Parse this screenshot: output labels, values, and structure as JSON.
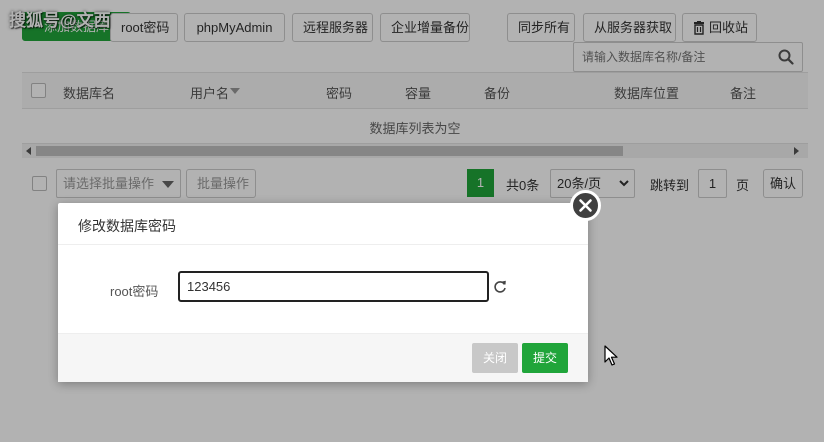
{
  "watermark": "搜狐号@文西",
  "toolbar": {
    "add_db": "添加数据库",
    "root_pw": "root密码",
    "phpmyadmin": "phpMyAdmin",
    "remote_server": "远程服务器",
    "enterprise_backup": "企业增量备份",
    "sync_all": "同步所有",
    "fetch_from_server": "从服务器获取",
    "recycle_bin": "回收站"
  },
  "search": {
    "placeholder": "请输入数据库名称/备注"
  },
  "table": {
    "columns": [
      "数据库名",
      "用户名",
      "密码",
      "容量",
      "备份",
      "数据库位置",
      "备注"
    ],
    "empty_text": "数据库列表为空"
  },
  "footer": {
    "batch_placeholder": "请选择批量操作",
    "batch_button": "批量操作",
    "current_page": "1",
    "total": "共0条",
    "per_page": "20条/页",
    "goto_label": "跳转到",
    "goto_value": "1",
    "page_unit": "页",
    "confirm": "确认"
  },
  "modal": {
    "title": "修改数据库密码",
    "field_label": "root密码",
    "field_value": "123456",
    "close_label": "关闭",
    "submit_label": "提交"
  },
  "colors": {
    "accent": "#20a53a",
    "overlay": "rgba(0,0,0,0.30)"
  }
}
